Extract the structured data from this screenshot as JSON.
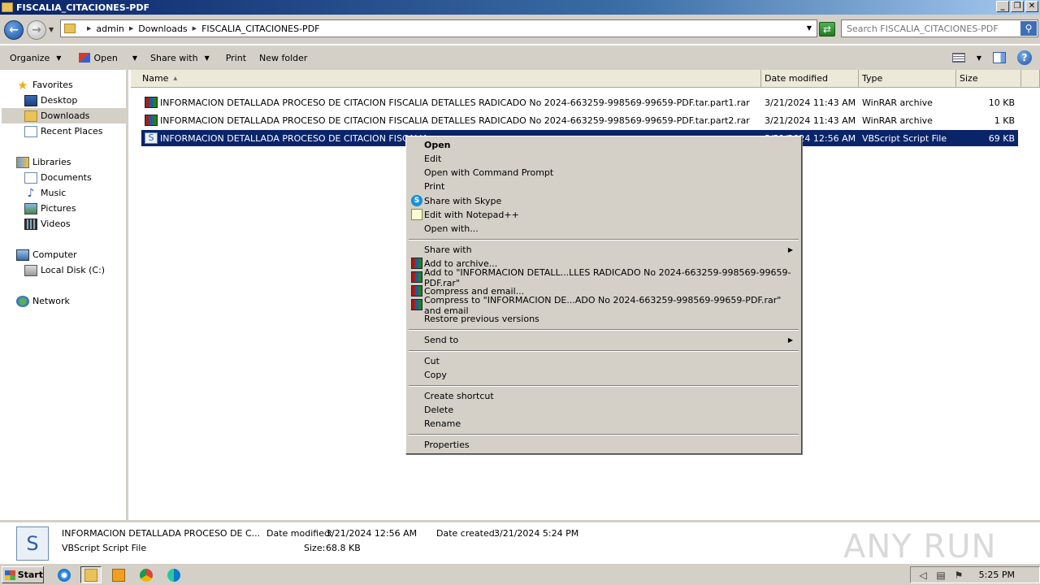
{
  "window": {
    "title": "FISCALIA_CITACIONES-PDF",
    "buttons": [
      "_",
      "❐",
      "✕"
    ]
  },
  "address": {
    "breadcrumb": [
      "admin",
      "Downloads",
      "FISCALIA_CITACIONES-PDF"
    ],
    "search_placeholder": "Search FISCALIA_CITACIONES-PDF"
  },
  "toolbar": {
    "organize": "Organize",
    "open": "Open",
    "share_with": "Share with",
    "print": "Print",
    "new_folder": "New folder"
  },
  "nav": {
    "favorites": "Favorites",
    "desktop": "Desktop",
    "downloads": "Downloads",
    "recent_places": "Recent Places",
    "libraries": "Libraries",
    "documents": "Documents",
    "music": "Music",
    "pictures": "Pictures",
    "videos": "Videos",
    "computer": "Computer",
    "local_disk": "Local Disk (C:)",
    "network": "Network"
  },
  "columns": {
    "name": "Name",
    "date_modified": "Date modified",
    "type": "Type",
    "size": "Size"
  },
  "files": [
    {
      "name": "INFORMACION DETALLADA PROCESO DE CITACION FISCALIA DETALLES RADICADO No 2024-663259-998569-99659-PDF.tar.part1.rar",
      "date": "3/21/2024 11:43 AM",
      "type": "WinRAR archive",
      "size": "10 KB"
    },
    {
      "name": "INFORMACION DETALLADA PROCESO DE CITACION FISCALIA DETALLES RADICADO No 2024-663259-998569-99659-PDF.tar.part2.rar",
      "date": "3/21/2024 11:43 AM",
      "type": "WinRAR archive",
      "size": "1 KB"
    },
    {
      "name": "INFORMACION DETALLADA PROCESO DE CITACION FISCALIA",
      "date": "3/21/2024 12:56 AM",
      "type": "VBScript Script File",
      "size": "69 KB"
    }
  ],
  "context_menu": {
    "open": "Open",
    "edit": "Edit",
    "open_cmd": "Open with Command Prompt",
    "print": "Print",
    "share_skype": "Share with Skype",
    "edit_npp": "Edit with Notepad++",
    "open_with": "Open with...",
    "share_with": "Share with",
    "add_archive": "Add to archive...",
    "add_to_rar": "Add to \"INFORMACION DETALL...LLES RADICADO No 2024-663259-998569-99659-PDF.rar\"",
    "compress_email": "Compress and email...",
    "compress_to_email": "Compress to \"INFORMACION DE...ADO No 2024-663259-998569-99659-PDF.rar\" and email",
    "restore": "Restore previous versions",
    "send_to": "Send to",
    "cut": "Cut",
    "copy": "Copy",
    "create_shortcut": "Create shortcut",
    "delete": "Delete",
    "rename": "Rename",
    "properties": "Properties"
  },
  "details": {
    "filename": "INFORMACION DETALLADA PROCESO DE C...",
    "filetype": "VBScript Script File",
    "date_modified_label": "Date modified:",
    "date_modified": "3/21/2024 12:56 AM",
    "date_created_label": "Date created:",
    "date_created": "3/21/2024 5:24 PM",
    "size_label": "Size:",
    "size": "68.8 KB",
    "watermark": "ANY RUN"
  },
  "taskbar": {
    "start": "Start",
    "clock": "5:25 PM"
  }
}
